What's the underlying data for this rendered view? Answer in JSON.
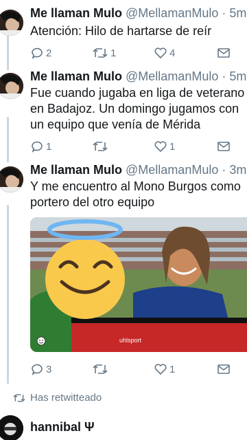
{
  "tweets": [
    {
      "name": "Me llaman Mulo",
      "handle": "@MellamanMulo",
      "time": "· 5m",
      "lines": [
        "Atención: Hilo de hartarse de reír"
      ],
      "replies": "2",
      "retweets": "1",
      "likes": "4"
    },
    {
      "name": "Me llaman Mulo",
      "handle": "@MellamanMulo",
      "time": "· 5m",
      "lines": [
        "Fue cuando jugaba en liga de veterano",
        "en Badajoz. Un domingo jugamos con",
        "un equipo que venía de Mérida"
      ],
      "replies": "1",
      "retweets": "",
      "likes": "1"
    },
    {
      "name": "Me llaman Mulo",
      "handle": "@MellamanMulo",
      "time": "· 3m",
      "lines": [
        "Y me encuentro al Mono Burgos como",
        "portero del otro equipo"
      ],
      "replies": "3",
      "retweets": "",
      "likes": "1"
    }
  ],
  "media": {
    "sticker_icon": "smiling-face-with-halo-emoji",
    "jersey_text": "uhlsport"
  },
  "retweet_notice": "Has retwitteado",
  "next_tweet": {
    "name": "hannibal Ψ"
  },
  "colors": {
    "text": "#14171a",
    "muted": "#657786",
    "divider": "#e6ecf0",
    "thread": "#ccd6dd"
  }
}
